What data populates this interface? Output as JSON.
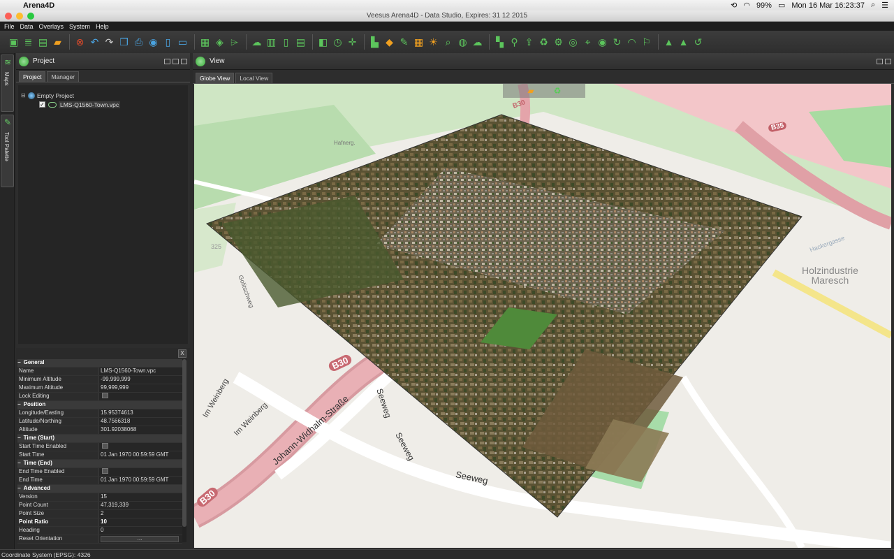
{
  "macbar": {
    "app_name": "Arena4D",
    "battery": "99%",
    "datetime": "Mon 16 Mar  16:23:37"
  },
  "window": {
    "title": "Veesus Arena4D - Data Studio, Expires: 31 12 2015"
  },
  "menu": {
    "items": [
      "File",
      "Data",
      "Overlays",
      "System",
      "Help"
    ]
  },
  "left_strip": {
    "maps_label": "Maps",
    "tool_palette_label": "Tool Palette"
  },
  "project_panel": {
    "title": "Project",
    "tabs": [
      "Project",
      "Manager"
    ],
    "tree": {
      "root": "Empty Project",
      "child": "LMS-Q1560-Town.vpc"
    }
  },
  "properties": {
    "sections": [
      {
        "title": "General",
        "rows": [
          {
            "k": "Name",
            "v": "LMS-Q1560-Town.vpc"
          },
          {
            "k": "Minimum Altitude",
            "v": "-99,999,999"
          },
          {
            "k": "Maximum Altitude",
            "v": "99,999,999"
          },
          {
            "k": "Lock Editing",
            "v": "",
            "checkbox": true
          }
        ]
      },
      {
        "title": "Position",
        "rows": [
          {
            "k": "Longitude/Easting",
            "v": "15.95374613"
          },
          {
            "k": "Latitude/Northing",
            "v": "48.7566318"
          },
          {
            "k": "Altitude",
            "v": "301.92038068"
          }
        ]
      },
      {
        "title": "Time (Start)",
        "rows": [
          {
            "k": "Start Time Enabled",
            "v": "",
            "checkbox": true
          },
          {
            "k": "Start Time",
            "v": "01 Jan 1970 00:59:59 GMT"
          }
        ]
      },
      {
        "title": "Time (End)",
        "rows": [
          {
            "k": "End Time Enabled",
            "v": "",
            "checkbox": true
          },
          {
            "k": "End Time",
            "v": "01 Jan 1970 00:59:59 GMT"
          }
        ]
      },
      {
        "title": "Advanced",
        "rows": [
          {
            "k": "Version",
            "v": "15"
          },
          {
            "k": "Point Count",
            "v": "47,319,339"
          },
          {
            "k": "Point Size",
            "v": "2"
          },
          {
            "k": "Point Ratio",
            "v": "10",
            "highlight": true
          },
          {
            "k": "Heading",
            "v": "0"
          },
          {
            "k": "Reset Orientation",
            "v": "...",
            "button": true
          }
        ]
      }
    ]
  },
  "view_panel": {
    "title": "View",
    "tabs": [
      "Globe View",
      "Local View"
    ]
  },
  "map_labels": {
    "b30_top": "B30",
    "b35": "B35",
    "b30_left": "B30",
    "b30_bottom": "B30",
    "holz_line1": "Holzindustrie",
    "holz_line2": "Maresch",
    "hackergasse": "Hackergasse",
    "im_weinberg_1": "Im Weinberg",
    "im_weinberg_2": "Im Weinberg",
    "johann": "Johann-Widhalm-Straße",
    "seeweg_1": "Seeweg",
    "seeweg_2": "Seeweg",
    "seeweg_3": "Seeweg",
    "golitschweg": "Golitschweg",
    "hafnerg": "Hafnerg.",
    "num_325": "325"
  },
  "status": {
    "text": "Coordinate System (EPSG): 4326"
  }
}
